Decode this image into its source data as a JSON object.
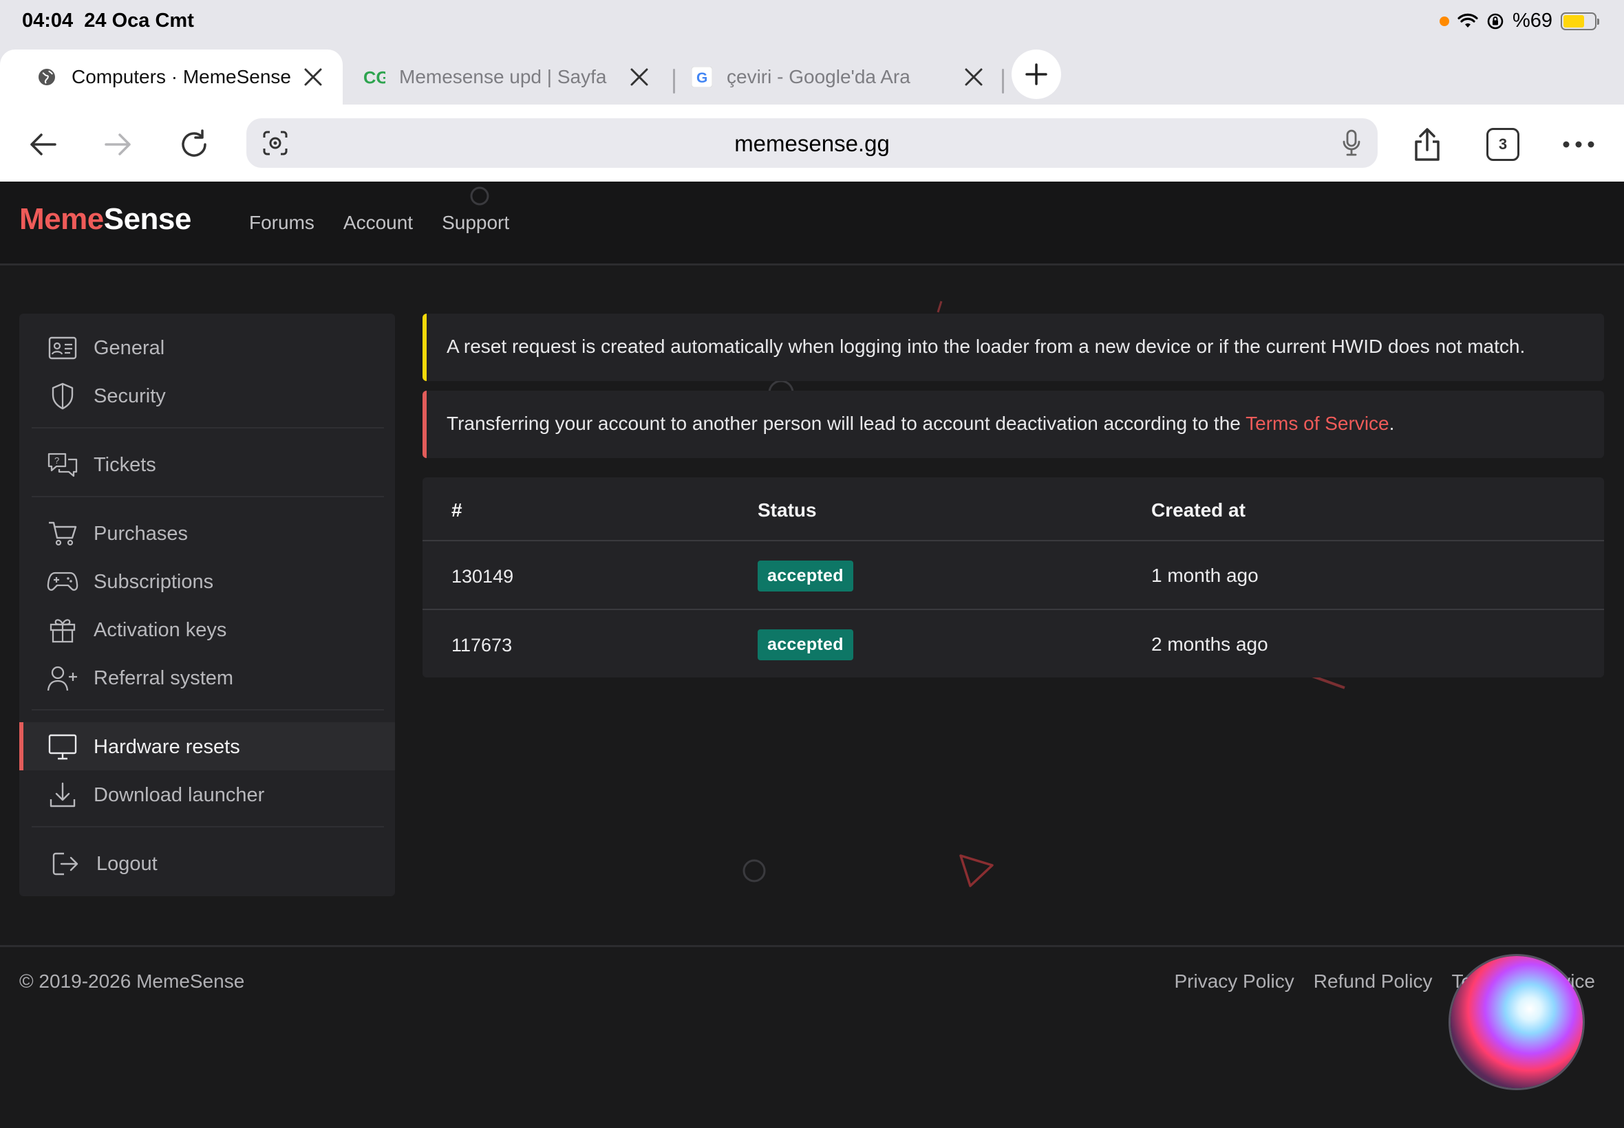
{
  "status_bar": {
    "time": "04:04",
    "date": "24 Oca Cmt",
    "battery": "%69",
    "battery_level": 0.69,
    "colors": {
      "battery": "#ffd60a",
      "indicator": "#ff8a00"
    }
  },
  "tabs": [
    {
      "title": "Computers · MemeSense",
      "icon": "globe-icon",
      "active": true
    },
    {
      "title": "Memesense upd | Sayfa",
      "icon": "cg-favicon-icon",
      "active": false
    },
    {
      "title": "çeviri - Google'da Ara",
      "icon": "google-favicon-icon",
      "active": false
    }
  ],
  "toolbar": {
    "url": "memesense.gg",
    "tab_count": "3"
  },
  "site": {
    "brand_first": "Meme",
    "brand_second": "Sense",
    "nav": [
      "Forums",
      "Account",
      "Support"
    ],
    "colors": {
      "brand": "#ef5b59",
      "warning": "#f5d90a",
      "danger": "#e25c5a",
      "badge": "#0e7766",
      "background": "#1a1a1b",
      "panel": "#232326"
    }
  },
  "sidebar": {
    "items": [
      {
        "label": "General",
        "icon": "id-card-icon"
      },
      {
        "label": "Security",
        "icon": "shield-icon"
      },
      {
        "label": "Tickets",
        "icon": "chat-bubbles-icon"
      },
      {
        "label": "Purchases",
        "icon": "cart-icon"
      },
      {
        "label": "Subscriptions",
        "icon": "gamepad-icon"
      },
      {
        "label": "Activation keys",
        "icon": "gift-icon"
      },
      {
        "label": "Referral system",
        "icon": "user-plus-icon"
      },
      {
        "label": "Hardware resets",
        "icon": "monitor-icon",
        "active": true
      },
      {
        "label": "Download launcher",
        "icon": "download-icon"
      },
      {
        "label": "Logout",
        "icon": "logout-icon"
      }
    ]
  },
  "alerts": {
    "warning_text": "A reset request is created automatically when logging into the loader from a new device or if the current HWID does not match.",
    "danger_text_before": "Transferring your account to another person will lead to account deactivation according to the ",
    "danger_link": "Terms of Service",
    "danger_text_after": "."
  },
  "table": {
    "headers": [
      "#",
      "Status",
      "Created at"
    ],
    "rows": [
      {
        "id": "130149",
        "status": "accepted",
        "created": "1 month ago"
      },
      {
        "id": "117673",
        "status": "accepted",
        "created": "2 months ago"
      }
    ]
  },
  "footer": {
    "copyright": "© 2019-2026 MemeSense",
    "links": [
      "Privacy Policy",
      "Refund Policy",
      "Terms of Service"
    ]
  }
}
